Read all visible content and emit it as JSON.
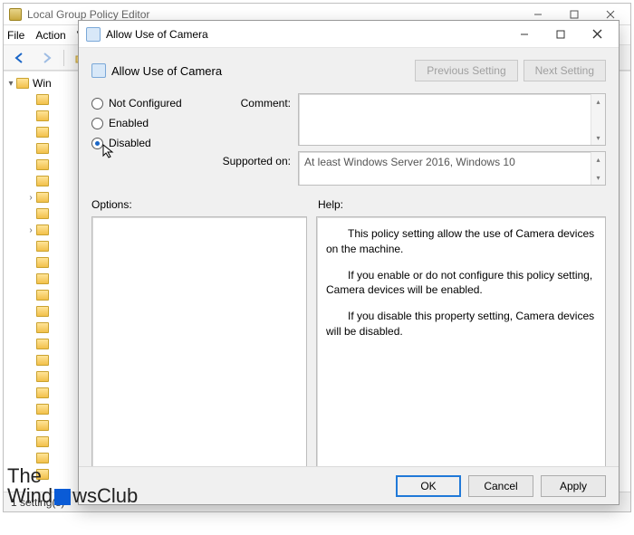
{
  "parent": {
    "title": "Local Group Policy Editor",
    "menu": [
      "File",
      "Action",
      "V"
    ],
    "tree_root_label": "Win",
    "folder_count": 24,
    "status": "1 setting(s)"
  },
  "dialog": {
    "title": "Allow Use of Camera",
    "header_title": "Allow Use of Camera",
    "nav": {
      "prev": "Previous Setting",
      "next": "Next Setting"
    },
    "radios": {
      "not_configured": "Not Configured",
      "enabled": "Enabled",
      "disabled": "Disabled",
      "selected": "disabled"
    },
    "labels": {
      "comment": "Comment:",
      "supported": "Supported on:",
      "options": "Options:",
      "help": "Help:"
    },
    "supported_text": "At least Windows Server 2016, Windows 10",
    "help_paragraphs": [
      "This policy setting allow the use of Camera devices on the machine.",
      "If you enable or do not configure this policy setting, Camera devices will be enabled.",
      "If you disable this property setting, Camera devices will be disabled."
    ],
    "buttons": {
      "ok": "OK",
      "cancel": "Cancel",
      "apply": "Apply"
    }
  },
  "watermark": {
    "line1": "The",
    "line2_a": "Wind",
    "line2_b": "wsClub"
  }
}
